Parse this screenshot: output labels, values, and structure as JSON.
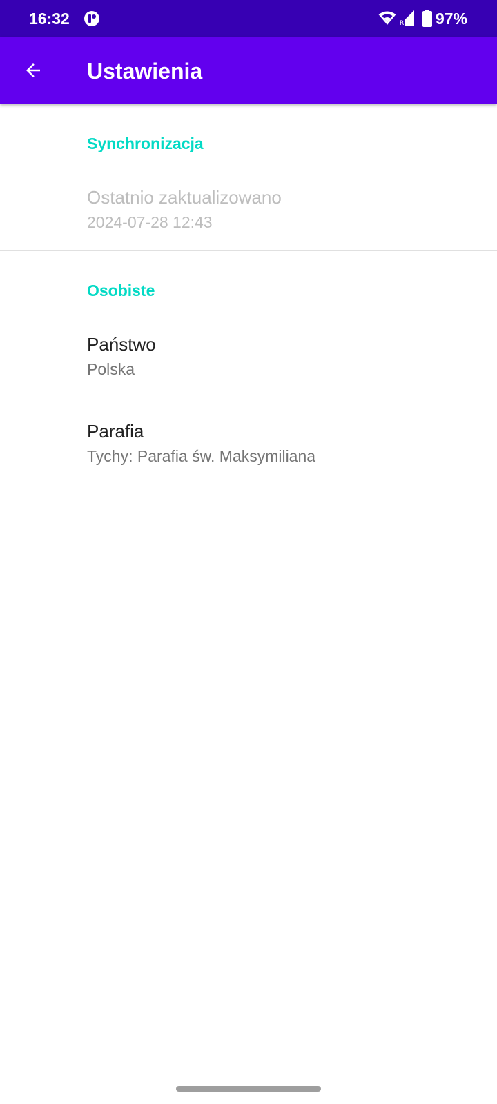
{
  "status_bar": {
    "time": "16:32",
    "battery": "97%",
    "icons": [
      "app-notification-icon",
      "wifi-icon",
      "signal-icon",
      "battery-icon"
    ]
  },
  "app_bar": {
    "back_icon": "arrow-left-icon",
    "title": "Ustawienia"
  },
  "sections": {
    "sync": {
      "header": "Synchronizacja",
      "last_updated": {
        "title": "Ostatnio zaktualizowano",
        "summary": "2024-07-28 12:43"
      }
    },
    "personal": {
      "header": "Osobiste",
      "country": {
        "title": "Państwo",
        "summary": "Polska"
      },
      "parish": {
        "title": "Parafia",
        "summary": "Tychy: Parafia św. Maksymiliana"
      }
    }
  },
  "colors": {
    "status_bar": "#3700b3",
    "app_bar": "#6200ee",
    "accent": "#03dac5",
    "disabled_text": "#bdbdbd",
    "secondary_text": "#757575"
  }
}
